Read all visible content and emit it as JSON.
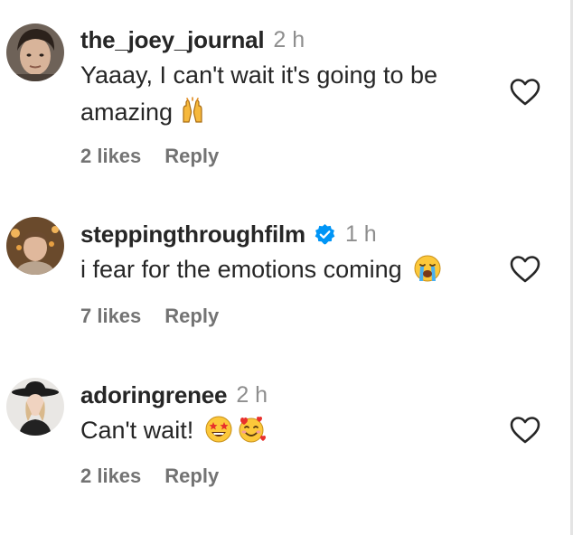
{
  "colors": {
    "text": "#262626",
    "muted": "#8e8e8e",
    "meta": "#737373",
    "verified": "#0095f6"
  },
  "comments": [
    {
      "username": "the_joey_journal",
      "time": "2 h",
      "text_line1": "Yaaay, I can't wait it's going to be",
      "text_line2": "amazing",
      "emojis": [
        "raising-hands-emoji"
      ],
      "likes": "2 likes",
      "reply": "Reply",
      "verified": false
    },
    {
      "username": "steppingthroughfilm",
      "time": "1 h",
      "text": "i fear for the emotions coming",
      "emojis": [
        "loudly-crying-face-emoji"
      ],
      "likes": "7 likes",
      "reply": "Reply",
      "verified": true
    },
    {
      "username": "adoringrenee",
      "time": "2 h",
      "text": "Can't wait!",
      "emojis": [
        "star-struck-emoji",
        "smiling-face-with-hearts-emoji"
      ],
      "likes": "2 likes",
      "reply": "Reply",
      "verified": false
    }
  ]
}
